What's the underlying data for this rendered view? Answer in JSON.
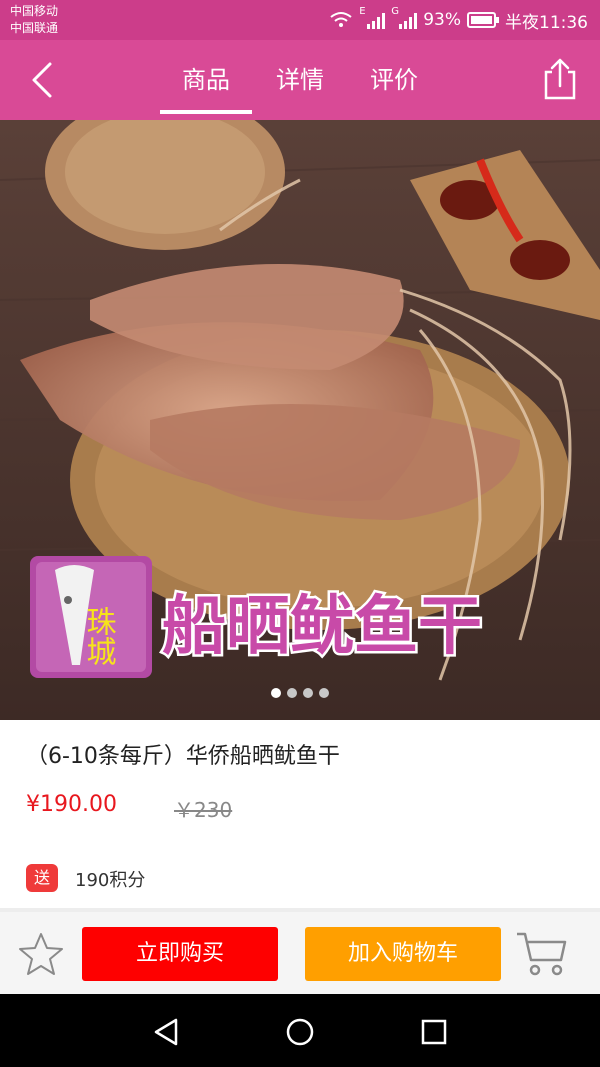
{
  "status_bar": {
    "carrier_1": "中国移动",
    "carrier_2": "中国联通",
    "signal_1_label": "E",
    "signal_2_label": "G",
    "battery": "93%",
    "time": "半夜11:36"
  },
  "header": {
    "back_icon": "chevron-left-icon",
    "tabs": [
      {
        "label": "商品",
        "active": true
      },
      {
        "label": "详情",
        "active": false
      },
      {
        "label": "评价",
        "active": false
      }
    ],
    "share_icon": "share-icon"
  },
  "product": {
    "image_overlay": {
      "logo_text": "珠城",
      "banner_text": "船晒鱿鱼干"
    },
    "carousel": {
      "total": 4,
      "active_index": 0
    },
    "title": "（6-10条每斤）华侨船晒鱿鱼干",
    "price": "¥190.00",
    "original_price": "￥230",
    "bonus_badge": "送",
    "bonus_points": "190积分"
  },
  "actions": {
    "favorite_icon": "star-icon",
    "buy_now": "立即购买",
    "add_to_cart": "加入购物车",
    "cart_icon": "cart-icon"
  },
  "colors": {
    "status_bar": "#cc3d8a",
    "header": "#d94a96",
    "price": "#e8171e",
    "buy_button": "#fe0000",
    "cart_button": "#ff9f00"
  }
}
